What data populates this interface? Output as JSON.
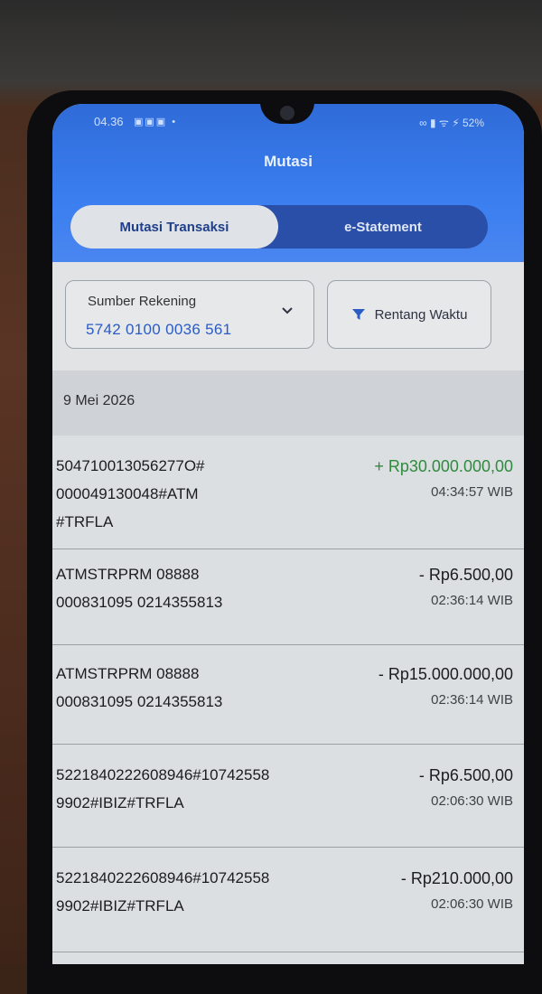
{
  "status_bar": {
    "time": "04.36",
    "left_icons": "▣▣▣ •",
    "right_text": "∞ ▮ ᯤ ⚡ 52%"
  },
  "header": {
    "title": "Mutasi",
    "tabs": [
      {
        "label": "Mutasi Transaksi",
        "active": true
      },
      {
        "label": "e-Statement",
        "active": false
      }
    ]
  },
  "filters": {
    "source_label": "Sumber Rekening",
    "source_value": "5742 0100 0036 561",
    "time_label": "Rentang Waktu"
  },
  "date_header": "9 Mei 2026",
  "transactions": [
    {
      "description": "504710013056277O#\n000049130048#ATM\n#TRFLA",
      "amount": "+ Rp30.000.000,00",
      "time": "04:34:57 WIB",
      "type": "credit"
    },
    {
      "description": "ATMSTRPRM 08888\n000831095 0214355813",
      "amount": "- Rp6.500,00",
      "time": "02:36:14 WIB",
      "type": "debit"
    },
    {
      "description": "ATMSTRPRM 08888\n000831095 0214355813",
      "amount": "- Rp15.000.000,00",
      "time": "02:36:14 WIB",
      "type": "debit"
    },
    {
      "description": "5221840222608946#10742558\n9902#IBIZ#TRFLA",
      "amount": "- Rp6.500,00",
      "time": "02:06:30 WIB",
      "type": "debit"
    },
    {
      "description": "5221840222608946#10742558\n9902#IBIZ#TRFLA",
      "amount": "- Rp210.000,00",
      "time": "02:06:30 WIB",
      "type": "debit"
    }
  ],
  "colors": {
    "header_blue": "#3a7ef0",
    "credit_green": "#2f8a3e",
    "account_blue": "#2b5cc4"
  }
}
